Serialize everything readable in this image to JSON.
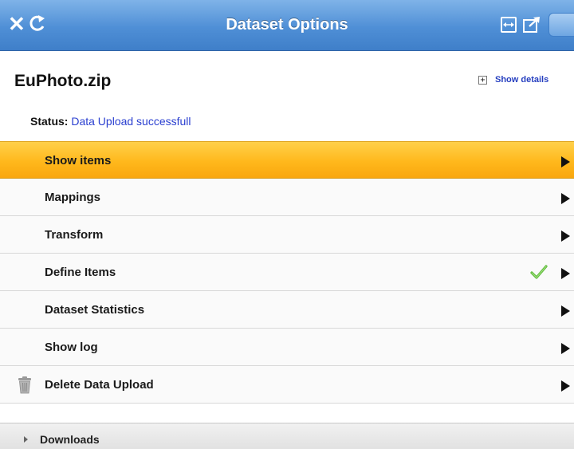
{
  "titlebar": {
    "title": "Dataset Options",
    "close_icon": "✕",
    "icons": [
      "close-icon",
      "refresh-icon",
      "expand-icon",
      "share-icon"
    ]
  },
  "dataset": {
    "name": "EuPhoto.zip",
    "show_details_label": "Show details",
    "status_label": "Status:",
    "status_value": "Data Upload successfull"
  },
  "menu": {
    "items": [
      {
        "label": "Show items",
        "selected": true
      },
      {
        "label": "Mappings"
      },
      {
        "label": "Transform"
      },
      {
        "label": "Define Items",
        "status_icon": "check-icon"
      },
      {
        "label": "Dataset Statistics"
      },
      {
        "label": "Show log"
      },
      {
        "label": "Delete Data Upload",
        "icon": "trash-icon"
      }
    ]
  },
  "downloads": {
    "label": "Downloads"
  },
  "colors": {
    "titlebar": "#4f8fd6",
    "selected": "#ffb81c",
    "status_value": "#2a3fd0",
    "check": "#5cb83a"
  }
}
